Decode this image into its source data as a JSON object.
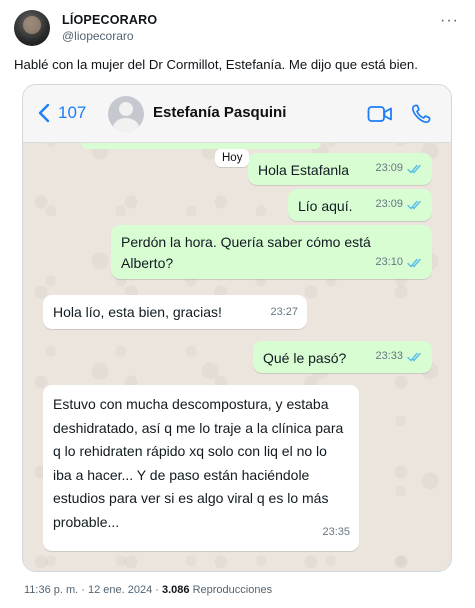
{
  "tweet": {
    "display_name": "LÍOPECORARO",
    "handle": "@liopecoraro",
    "text": "Hablé con la mujer del Dr Cormillot, Estefanía. Me dijo que está bien.",
    "timestamp": "11:36 p. m. · 12 ene. 2024 · ",
    "views_count": "3.086",
    "views_label": " Reproducciones"
  },
  "chat": {
    "back_count": "107",
    "contact_name": "Estefanía Pasquini",
    "day_chip": "Hoy",
    "messages": [
      {
        "direction": "out",
        "text": "Hola Estafanla",
        "time": "23:09",
        "read": true
      },
      {
        "direction": "out",
        "text": "Lío aquí.",
        "time": "23:09",
        "read": true
      },
      {
        "direction": "out",
        "text": "Perdón la hora. Quería saber cómo está Alberto?",
        "time": "23:10",
        "read": true
      },
      {
        "direction": "in",
        "text": "Hola lío, esta bien, gracias!",
        "time": "23:27",
        "read": false
      },
      {
        "direction": "out",
        "text": "Qué le pasó?",
        "time": "23:33",
        "read": true
      },
      {
        "direction": "in",
        "text": "Estuvo con mucha descompostura, y estaba deshidratado, así q me lo traje a la clínica para q lo rehidraten rápido xq solo con liq el no lo iba a hacer... Y de paso están haciéndole estudios para ver si es algo viral q es lo más probable...",
        "time": "23:35",
        "read": false
      }
    ]
  },
  "colors": {
    "accent_blue": "#1e7ef7",
    "outgoing_bubble": "#d9fdd3",
    "incoming_bubble": "#ffffff",
    "read_ticks": "#53bdeb"
  },
  "icons": [
    "more-icon",
    "back-chevron-icon",
    "video-call-icon",
    "phone-call-icon",
    "read-ticks-icon"
  ]
}
